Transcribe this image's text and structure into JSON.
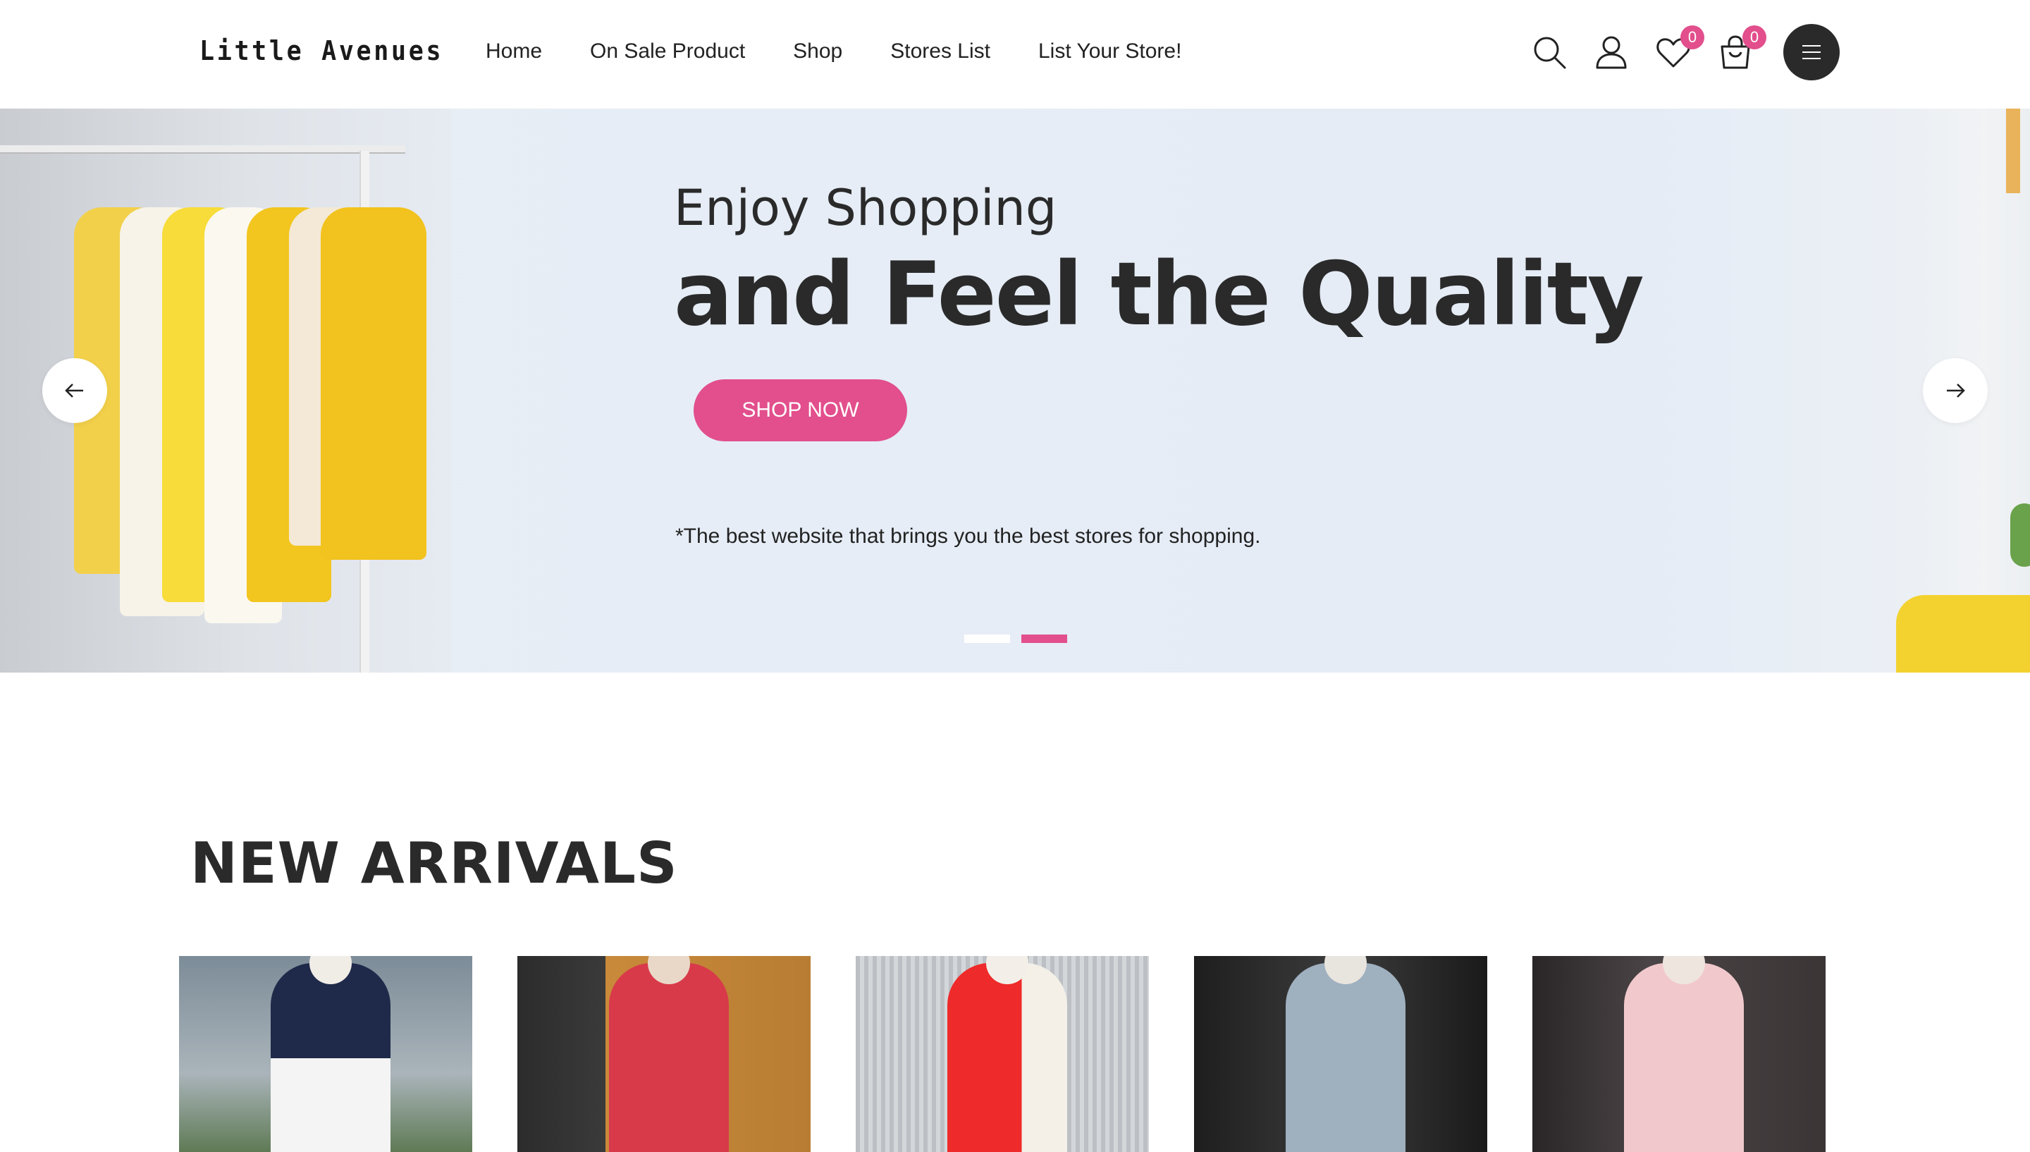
{
  "header": {
    "logo": "Little Avenues",
    "nav": [
      {
        "label": "Home"
      },
      {
        "label": "On Sale Product"
      },
      {
        "label": "Shop"
      },
      {
        "label": "Stores List"
      },
      {
        "label": "List Your Store!"
      }
    ],
    "icons": {
      "search": "search-icon",
      "account": "user-icon",
      "wishlist": "heart-icon",
      "cart": "shopping-bag-icon",
      "menu": "hamburger-menu-icon"
    },
    "wishlist_count": "0",
    "cart_count": "0"
  },
  "hero": {
    "subtitle": "Enjoy Shopping",
    "title": "and Feel the Quality",
    "cta_label": "SHOP NOW",
    "tagline": "*The best website that brings you the best stores for shopping.",
    "slide_count": 2,
    "active_slide": 2,
    "prev_icon": "arrow-left-icon",
    "next_icon": "arrow-right-icon"
  },
  "new_arrivals": {
    "title": "NEW ARRIVALS",
    "products": [
      {
        "image": "product-image-navy-white-blouse"
      },
      {
        "image": "product-image-red-jacket"
      },
      {
        "image": "product-image-red-white-top"
      },
      {
        "image": "product-image-grey-blue-shirt"
      },
      {
        "image": "product-image-pink-long-shirt"
      }
    ]
  },
  "colors": {
    "accent": "#e24f8c",
    "text_dark": "#2a2a2a",
    "hero_bg": "#e6edf6",
    "menu_button": "#2a2a2a"
  }
}
